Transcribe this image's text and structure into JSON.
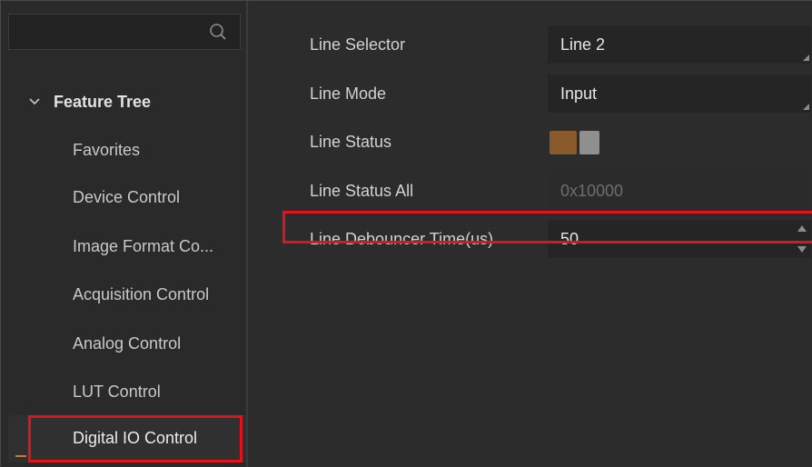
{
  "sidebar": {
    "search_placeholder": "",
    "tree_title": "Feature Tree",
    "items": [
      {
        "label": "Favorites"
      },
      {
        "label": "Device Control"
      },
      {
        "label": "Image Format Co..."
      },
      {
        "label": "Acquisition Control"
      },
      {
        "label": "Analog Control"
      },
      {
        "label": "LUT Control"
      },
      {
        "label": "Digital IO Control",
        "selected": true
      }
    ]
  },
  "properties": {
    "line_selector": {
      "label": "Line Selector",
      "value": "Line 2"
    },
    "line_mode": {
      "label": "Line Mode",
      "value": "Input"
    },
    "line_status": {
      "label": "Line Status",
      "state": "on"
    },
    "line_status_all": {
      "label": "Line Status All",
      "value": "0x10000"
    },
    "line_debouncer_time": {
      "label": "Line Debouncer Time(us)",
      "value": "50"
    }
  },
  "colors": {
    "highlight": "#e0141a",
    "toggle_on": "#8a5a2a",
    "accent": "#c77a2e"
  }
}
